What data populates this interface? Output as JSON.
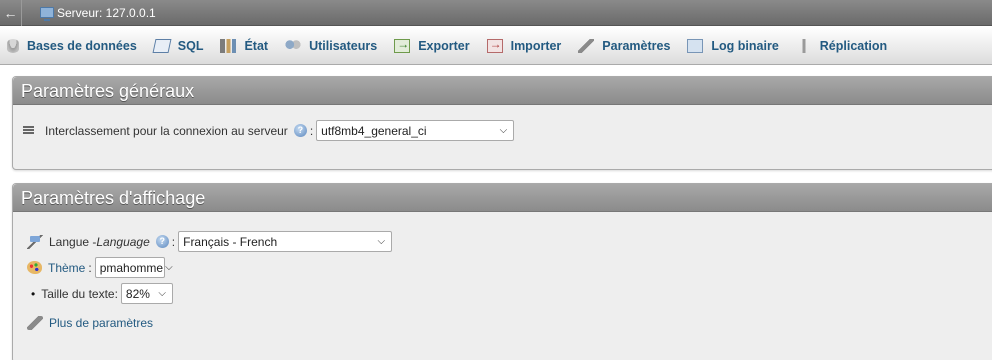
{
  "topbar": {
    "back_glyph": "←",
    "server_label": "Serveur: 127.0.0.1"
  },
  "tabs": [
    {
      "label": "Bases de données",
      "icon": "database-icon"
    },
    {
      "label": "SQL",
      "icon": "sql-icon"
    },
    {
      "label": "État",
      "icon": "status-icon"
    },
    {
      "label": "Utilisateurs",
      "icon": "users-icon"
    },
    {
      "label": "Exporter",
      "icon": "export-icon"
    },
    {
      "label": "Importer",
      "icon": "import-icon"
    },
    {
      "label": "Paramètres",
      "icon": "wrench-icon"
    },
    {
      "label": "Log binaire",
      "icon": "log-icon"
    },
    {
      "label": "Réplication",
      "icon": "replication-icon"
    }
  ],
  "general": {
    "title": "Paramètres généraux",
    "collation_label": "Interclassement pour la connexion au serveur",
    "collation_value": "utf8mb4_general_ci"
  },
  "display": {
    "title": "Paramètres d'affichage",
    "language_label": "Langue - ",
    "language_label_em": "Language",
    "language_value": "Français - French",
    "theme_label": "Thème",
    "theme_value": "pmahomme",
    "text_size_label": "Taille du texte:",
    "text_size_value": "82%",
    "more_settings": "Plus de paramètres"
  },
  "colors": {
    "link": "#235a81",
    "panel_header": "#9a9a9a",
    "panel_bg": "#eeeeee"
  }
}
